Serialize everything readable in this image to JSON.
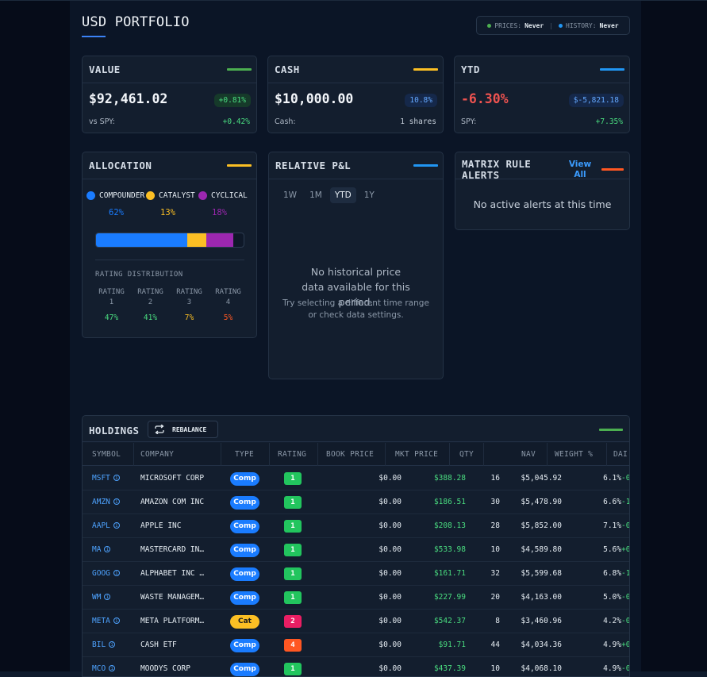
{
  "page": {
    "title": "USD PORTFOLIO",
    "status": {
      "prices_label": "PRICES:",
      "prices_value": "Never",
      "history_label": "HISTORY:",
      "history_value": "Never",
      "separator": "|"
    }
  },
  "colors": {
    "green": "#4caf50",
    "yellow": "#fbbf24",
    "blue": "#2196f3",
    "orange": "#ff5722",
    "purple": "#9c27b0",
    "pos": "#4ade80",
    "neg": "#ef5350"
  },
  "cards": {
    "value": {
      "title": "VALUE",
      "amount": "$92,461.02",
      "badge": "+0.81%",
      "sub_label": "vs SPY:",
      "sub_value": "+0.42%"
    },
    "cash": {
      "title": "CASH",
      "amount": "$10,000.00",
      "badge": "10.8%",
      "sub_label": "Cash:",
      "sub_value": "1 shares"
    },
    "ytd": {
      "title": "YTD",
      "amount": "-6.30%",
      "badge": "$-5,821.18",
      "sub_label": "SPY:",
      "sub_value": "+7.35%"
    }
  },
  "allocation": {
    "title": "ALLOCATION",
    "segments": [
      {
        "label": "COMPOUNDER",
        "pct": "62%",
        "fraction": 0.62,
        "color": "#1a7cff"
      },
      {
        "label": "CATALYST",
        "pct": "13%",
        "fraction": 0.13,
        "color": "#fbbf24"
      },
      {
        "label": "CYCLICAL",
        "pct": "18%",
        "fraction": 0.18,
        "color": "#9c27b0"
      }
    ],
    "rating_title": "RATING DISTRIBUTION",
    "ratings": [
      {
        "label": "RATING",
        "num": "1",
        "pct": "47%",
        "color": "#4ade80"
      },
      {
        "label": "RATING",
        "num": "2",
        "pct": "41%",
        "color": "#4ade80"
      },
      {
        "label": "RATING",
        "num": "3",
        "pct": "7%",
        "color": "#fbbf24"
      },
      {
        "label": "RATING",
        "num": "4",
        "pct": "5%",
        "color": "#ff5722"
      }
    ]
  },
  "relative_pnl": {
    "title": "RELATIVE P&L",
    "tabs": [
      "1W",
      "1M",
      "YTD",
      "1Y"
    ],
    "active_tab": "YTD",
    "empty_main": "No historical price data available for this period.",
    "empty_sub": "Try selecting a different time range or check data settings."
  },
  "alerts": {
    "title_line1": "MATRIX RULE",
    "title_line2": "ALERTS",
    "view_all_line1": "View",
    "view_all_line2": "All",
    "empty": "No active alerts at this time"
  },
  "holdings": {
    "title": "HOLDINGS",
    "rebalance_label": "REBALANCE",
    "columns": [
      "SYMBOL",
      "COMPANY",
      "TYPE",
      "RATING",
      "BOOK PRICE",
      "MKT PRICE",
      "QTY",
      "NAV",
      "WEIGHT %",
      "DAI"
    ],
    "rows": [
      {
        "symbol": "MSFT",
        "company": "MICROSOFT CORP",
        "type": "Comp",
        "rating": "1",
        "book": "$0.00",
        "mkt": "$388.28",
        "qty": "16",
        "nav": "$5,045.92",
        "weight": "6.1%",
        "day": "-0"
      },
      {
        "symbol": "AMZN",
        "company": "AMAZON COM INC",
        "type": "Comp",
        "rating": "1",
        "book": "$0.00",
        "mkt": "$186.51",
        "qty": "30",
        "nav": "$5,478.90",
        "weight": "6.6%",
        "day": "-1"
      },
      {
        "symbol": "AAPL",
        "company": "APPLE INC",
        "type": "Comp",
        "rating": "1",
        "book": "$0.00",
        "mkt": "$208.13",
        "qty": "28",
        "nav": "$5,852.00",
        "weight": "7.1%",
        "day": "-0"
      },
      {
        "symbol": "MA",
        "company": "MASTERCARD IN…",
        "type": "Comp",
        "rating": "1",
        "book": "$0.00",
        "mkt": "$533.98",
        "qty": "10",
        "nav": "$4,589.80",
        "weight": "5.6%",
        "day": "+0"
      },
      {
        "symbol": "GOOG",
        "company": "ALPHABET INC …",
        "type": "Comp",
        "rating": "1",
        "book": "$0.00",
        "mkt": "$161.71",
        "qty": "32",
        "nav": "$5,599.68",
        "weight": "6.8%",
        "day": "-1"
      },
      {
        "symbol": "WM",
        "company": "WASTE MANAGEM…",
        "type": "Comp",
        "rating": "1",
        "book": "$0.00",
        "mkt": "$227.99",
        "qty": "20",
        "nav": "$4,163.00",
        "weight": "5.0%",
        "day": "-0"
      },
      {
        "symbol": "META",
        "company": "META PLATFORM…",
        "type": "Cat",
        "rating": "2",
        "book": "$0.00",
        "mkt": "$542.37",
        "qty": "8",
        "nav": "$3,460.96",
        "weight": "4.2%",
        "day": "-0"
      },
      {
        "symbol": "BIL",
        "company": "CASH ETF",
        "type": "Comp",
        "rating": "4",
        "book": "$0.00",
        "mkt": "$91.71",
        "qty": "44",
        "nav": "$4,034.36",
        "weight": "4.9%",
        "day": "+0"
      },
      {
        "symbol": "MCO",
        "company": "MOODYS CORP",
        "type": "Comp",
        "rating": "1",
        "book": "$0.00",
        "mkt": "$437.39",
        "qty": "10",
        "nav": "$4,068.10",
        "weight": "4.9%",
        "day": "-0"
      }
    ]
  }
}
